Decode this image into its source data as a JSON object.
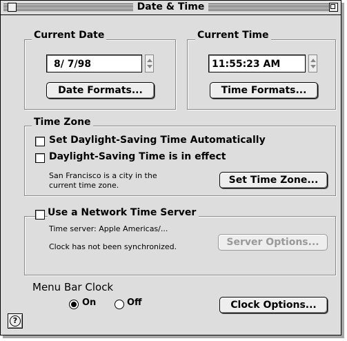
{
  "window": {
    "title": "Date & Time"
  },
  "current_date": {
    "heading": "Current Date",
    "value": "8/ 7/98",
    "formats_button": "Date Formats..."
  },
  "current_time": {
    "heading": "Current Time",
    "value": "11:55:23 AM",
    "formats_button": "Time Formats..."
  },
  "time_zone": {
    "heading": "Time Zone",
    "dst_auto_label": "Set Daylight-Saving Time Automatically",
    "dst_auto_checked": false,
    "dst_effect_label": "Daylight-Saving Time is in effect",
    "dst_effect_checked": false,
    "info_line1": "San Francisco is a city in the",
    "info_line2": "current time zone.",
    "set_button": "Set Time Zone..."
  },
  "network": {
    "label": "Use a Network Time Server",
    "checked": false,
    "server_text": "Time server: Apple Americas/...",
    "status_text": "Clock has not been synchronized.",
    "options_button": "Server Options..."
  },
  "menu_bar_clock": {
    "heading": "Menu Bar Clock",
    "on_label": "On",
    "off_label": "Off",
    "selected": "On",
    "options_button": "Clock Options..."
  },
  "help": {
    "label": "?"
  }
}
